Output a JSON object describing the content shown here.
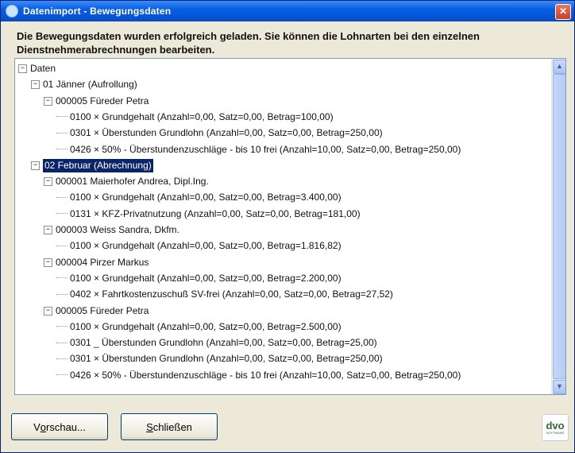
{
  "window": {
    "title": "Datenimport - Bewegungsdaten",
    "close_glyph": "✕"
  },
  "message": "Die Bewegungsdaten wurden erfolgreich geladen. Sie können die Lohnarten bei den einzelnen Dienstnehmerabrechnungen bearbeiten.",
  "tree": {
    "root": "Daten",
    "months": [
      {
        "label": "01 Jänner (Aufrollung)",
        "selected": false,
        "employees": [
          {
            "label": "000005 Füreder Petra",
            "items": [
              "0100 × Grundgehalt (Anzahl=0,00, Satz=0,00, Betrag=100,00)",
              "0301 × Überstunden Grundlohn (Anzahl=0,00, Satz=0,00, Betrag=250,00)",
              "0426 × 50% - Überstundenzuschläge - bis 10 frei (Anzahl=10,00, Satz=0,00, Betrag=250,00)"
            ]
          }
        ]
      },
      {
        "label": "02 Februar (Abrechnung)",
        "selected": true,
        "employees": [
          {
            "label": "000001 Maierhofer Andrea, Dipl.Ing.",
            "items": [
              "0100 × Grundgehalt (Anzahl=0,00, Satz=0,00, Betrag=3.400,00)",
              "0131 × KFZ-Privatnutzung (Anzahl=0,00, Satz=0,00, Betrag=181,00)"
            ]
          },
          {
            "label": "000003 Weiss Sandra, Dkfm.",
            "items": [
              "0100 × Grundgehalt (Anzahl=0,00, Satz=0,00, Betrag=1.816,82)"
            ]
          },
          {
            "label": "000004 Pirzer Markus",
            "items": [
              "0100 × Grundgehalt (Anzahl=0,00, Satz=0,00, Betrag=2.200,00)",
              "0402 × Fahrtkostenzuschuß SV-frei (Anzahl=0,00, Satz=0,00, Betrag=27,52)"
            ]
          },
          {
            "label": "000005 Füreder Petra",
            "items": [
              "0100 × Grundgehalt (Anzahl=0,00, Satz=0,00, Betrag=2.500,00)",
              "0301 _ Überstunden Grundlohn (Anzahl=0,00, Satz=0,00, Betrag=25,00)",
              "0301 × Überstunden Grundlohn (Anzahl=0,00, Satz=0,00, Betrag=250,00)",
              "0426 × 50% - Überstundenzuschläge - bis 10 frei (Anzahl=10,00, Satz=0,00, Betrag=250,00)"
            ]
          }
        ]
      }
    ],
    "expander_glyph": "−"
  },
  "scrollbar": {
    "up_glyph": "▲",
    "down_glyph": "▼"
  },
  "buttons": {
    "preview": {
      "accel": "o",
      "pre": "V",
      "post": "rschau..."
    },
    "close": {
      "accel": "S",
      "pre": "",
      "post": "chließen"
    }
  },
  "logo": {
    "text": "dvo",
    "sub": "SOFTWARE"
  }
}
